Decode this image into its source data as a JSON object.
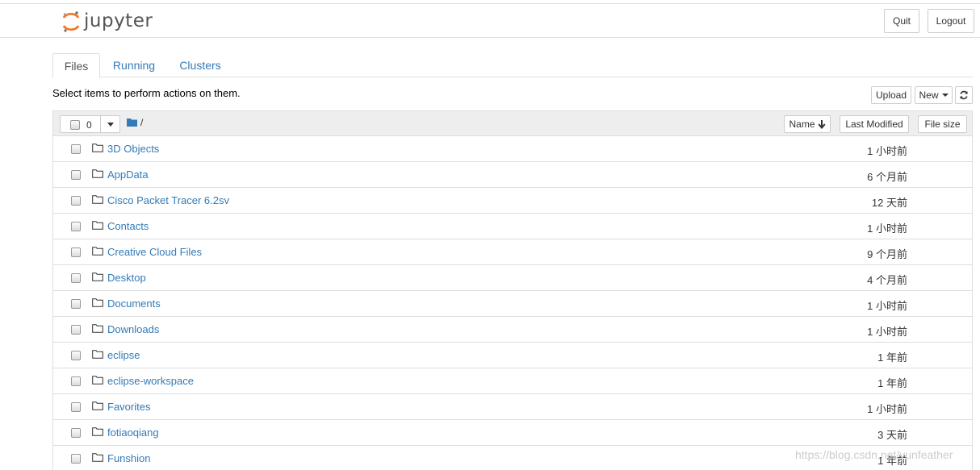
{
  "app": {
    "logo_text": "jupyter"
  },
  "header": {
    "quit_label": "Quit",
    "logout_label": "Logout"
  },
  "tabs": [
    {
      "label": "Files",
      "active": true
    },
    {
      "label": "Running",
      "active": false
    },
    {
      "label": "Clusters",
      "active": false
    }
  ],
  "toolbar": {
    "select_message": "Select items to perform actions on them.",
    "upload_label": "Upload",
    "new_label": "New"
  },
  "list_header": {
    "selected_count": "0",
    "breadcrumb": "/",
    "name_label": "Name",
    "last_modified_label": "Last Modified",
    "file_size_label": "File size"
  },
  "items": [
    {
      "name": "3D Objects",
      "modified": "1 小时前"
    },
    {
      "name": "AppData",
      "modified": "6 个月前"
    },
    {
      "name": "Cisco Packet Tracer 6.2sv",
      "modified": "12 天前"
    },
    {
      "name": "Contacts",
      "modified": "1 小时前"
    },
    {
      "name": "Creative Cloud Files",
      "modified": "9 个月前"
    },
    {
      "name": "Desktop",
      "modified": "4 个月前"
    },
    {
      "name": "Documents",
      "modified": "1 小时前"
    },
    {
      "name": "Downloads",
      "modified": "1 小时前"
    },
    {
      "name": "eclipse",
      "modified": "1 年前"
    },
    {
      "name": "eclipse-workspace",
      "modified": "1 年前"
    },
    {
      "name": "Favorites",
      "modified": "1 小时前"
    },
    {
      "name": "fotiaoqiang",
      "modified": "3 天前"
    },
    {
      "name": "Funshion",
      "modified": "1 年前"
    }
  ],
  "watermark": "https://blog.csdn.net/yunfeather",
  "colors": {
    "link": "#337ab7",
    "logo_orange": "#f37726"
  }
}
